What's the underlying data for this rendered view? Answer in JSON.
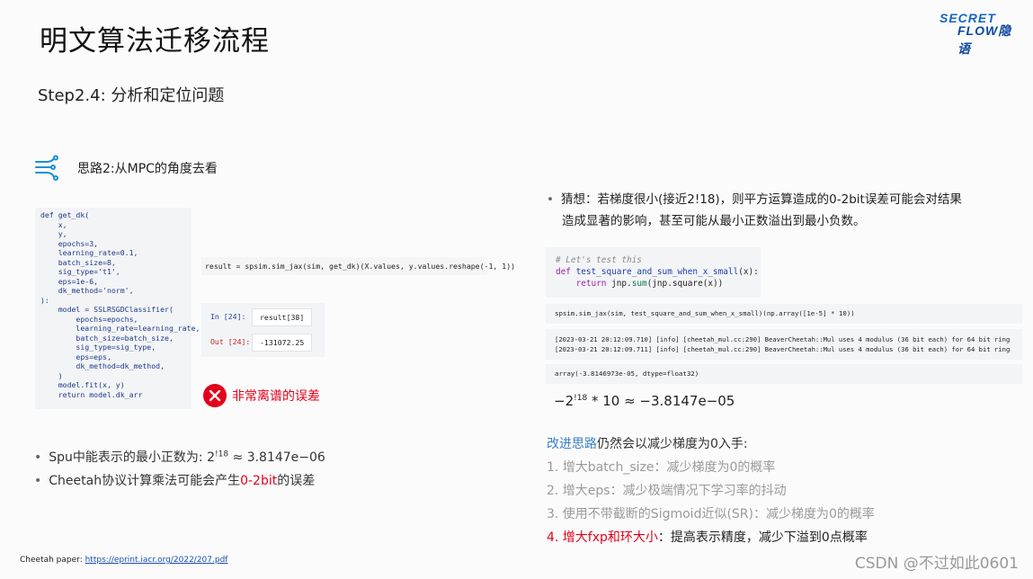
{
  "title": "明文算法迁移流程",
  "subtitle": "Step2.4: 分析和定位问题",
  "logo": {
    "line1": "SECRET",
    "line2": "FLOW隐语"
  },
  "idea": {
    "icon": "flow-icon",
    "text": "思路2:从MPC的角度去看"
  },
  "code_left": "def get_dk(\n    x,\n    y,\n    epochs=3,\n    learning_rate=0.1,\n    batch_size=8,\n    sig_type='t1',\n    eps=1e-6,\n    dk_method='norm',\n):\n    model = SSLRSGDClassifier(\n        epochs=epochs,\n        learning_rate=learning_rate,\n        batch_size=batch_size,\n        sig_type=sig_type,\n        eps=eps,\n        dk_method=dk_method,\n    )\n    model.fit(x, y)\n    return model.dk_arr",
  "result_line": "result = spsim.sim_jax(sim, get_dk)(X.values, y.values.reshape(-1, 1))",
  "io": {
    "in_label": "In [24]:",
    "in_value": "result[38]",
    "out_label": "Out [24]:",
    "out_value": "-131072.25"
  },
  "error_note": "非常离谱的误差",
  "bullets_left": {
    "b1_text": "Spu中能表示的最小正数为: 2",
    "b1_sup": "!18",
    "b1_tail": " ≈ 3.8147e−06",
    "b2_pre": "Cheetah协议计算乘法可能会产生",
    "b2_red": "0-2bit",
    "b2_post": "的误差"
  },
  "paper": {
    "label": "Cheetah paper: ",
    "link": "https://eprint.iacr.org/2022/207.pdf"
  },
  "guess": {
    "line1": "猜想：若梯度很小(接近2!18)，则平方运算造成的0-2bit误差可能会对结果",
    "line2": "造成显著的影响，甚至可能从最小正数溢出到最小负数。"
  },
  "code_right": {
    "comment": "# Let's test this",
    "kw_def": "def",
    "fn_name": "test_square_and_sum_when_x_small",
    "fn_args": "(x):",
    "kw_return": "return",
    "ret_pre": "jnp.",
    "bi_sum": "sum",
    "ret_post": "(jnp.square(x))"
  },
  "sim_line": "spsim.sim_jax(sim, test_square_and_sum_when_x_small)(np.array([1e-5] * 10))",
  "log_lines": [
    "[2023-03-21 20:12:09.710] [info] [cheetah_mul.cc:290] BeaverCheetah::Mul uses 4 modulus (36 bit each) for 64 bit ring",
    "[2023-03-21 20:12:09.711] [info] [cheetah_mul.cc:290] BeaverCheetah::Mul uses 4 modulus (36 bit each) for 64 bit ring"
  ],
  "arr_line": "array(-3.8146973e-05, dtype=float32)",
  "formula": {
    "pre": "−2",
    "sup": "!18",
    "post": " * 10  ≈ −3.8147e−05"
  },
  "improve": {
    "link": "改进思路",
    "rest": "仍然会以减少梯度为0入手:"
  },
  "steps": [
    "1.  增大batch_size：减少梯度为0的概率",
    "2.  增大eps：减少极端情况下学习率的抖动",
    "3.  使用不带截断的Sigmoid近似(SR)：减少梯度为0的概率"
  ],
  "step4": {
    "red": "4.  增大fxp和环大小",
    "rest": "：提高表示精度，减少下溢到0点概率"
  },
  "watermark": "CSDN @不过如此0601",
  "colors": {
    "accent_red": "#e3001b",
    "link_blue": "#3b82c4",
    "logo_blue": "#1565c0"
  }
}
